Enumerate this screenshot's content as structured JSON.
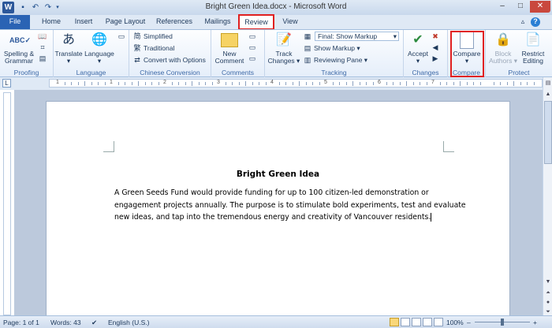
{
  "window": {
    "title": "Bright Green Idea.docx - Microsoft Word",
    "app_icon": "W",
    "controls": {
      "minimize": "–",
      "maximize": "□",
      "close": "✕"
    }
  },
  "tabs": [
    {
      "label": "File"
    },
    {
      "label": "Home"
    },
    {
      "label": "Insert"
    },
    {
      "label": "Page Layout"
    },
    {
      "label": "References"
    },
    {
      "label": "Mailings"
    },
    {
      "label": "Review"
    },
    {
      "label": "View"
    }
  ],
  "active_tab": "Review",
  "ribbon": {
    "proofing": {
      "label": "Proofing",
      "spelling": "Spelling &",
      "spelling2": "Grammar"
    },
    "language": {
      "label": "Language",
      "translate": "Translate",
      "language": "Language"
    },
    "chinese": {
      "label": "Chinese Conversion",
      "simplified": "Simplified",
      "traditional": "Traditional",
      "convert": "Convert with Options"
    },
    "comments": {
      "label": "Comments",
      "new1": "New",
      "new2": "Comment"
    },
    "tracking": {
      "label": "Tracking",
      "track1": "Track",
      "track2": "Changes",
      "display_for_review": "Final: Show Markup",
      "show_markup": "Show Markup",
      "reviewing_pane": "Reviewing Pane"
    },
    "changes": {
      "label": "Changes",
      "accept": "Accept"
    },
    "compare": {
      "label": "Compare",
      "compare": "Compare"
    },
    "protect": {
      "label": "Protect",
      "block1": "Block",
      "block2": "Authors",
      "restrict1": "Restrict",
      "restrict2": "Editing"
    }
  },
  "document": {
    "title": "Bright Green Idea",
    "lines": [
      " A Green Seeds Fund would provide funding for up to 100  citizen-led demonstration or",
      "engagement projects annually. The purpose is to stimulate bold experiments, test and evaluate",
      "new ideas, and tap into the tremendous energy and creativity of Vancouver residents."
    ]
  },
  "status": {
    "page": "Page: 1 of 1",
    "words": "Words: 43",
    "language": "English (U.S.)",
    "zoom": "100%",
    "zoom_minus": "–",
    "zoom_plus": "+"
  },
  "ruler": {
    "numbers": [
      "1",
      "1",
      "2",
      "3",
      "4",
      "5",
      "6",
      "7"
    ]
  },
  "highlight_color": "#e02020",
  "file_tab_color": "#2a63b4"
}
